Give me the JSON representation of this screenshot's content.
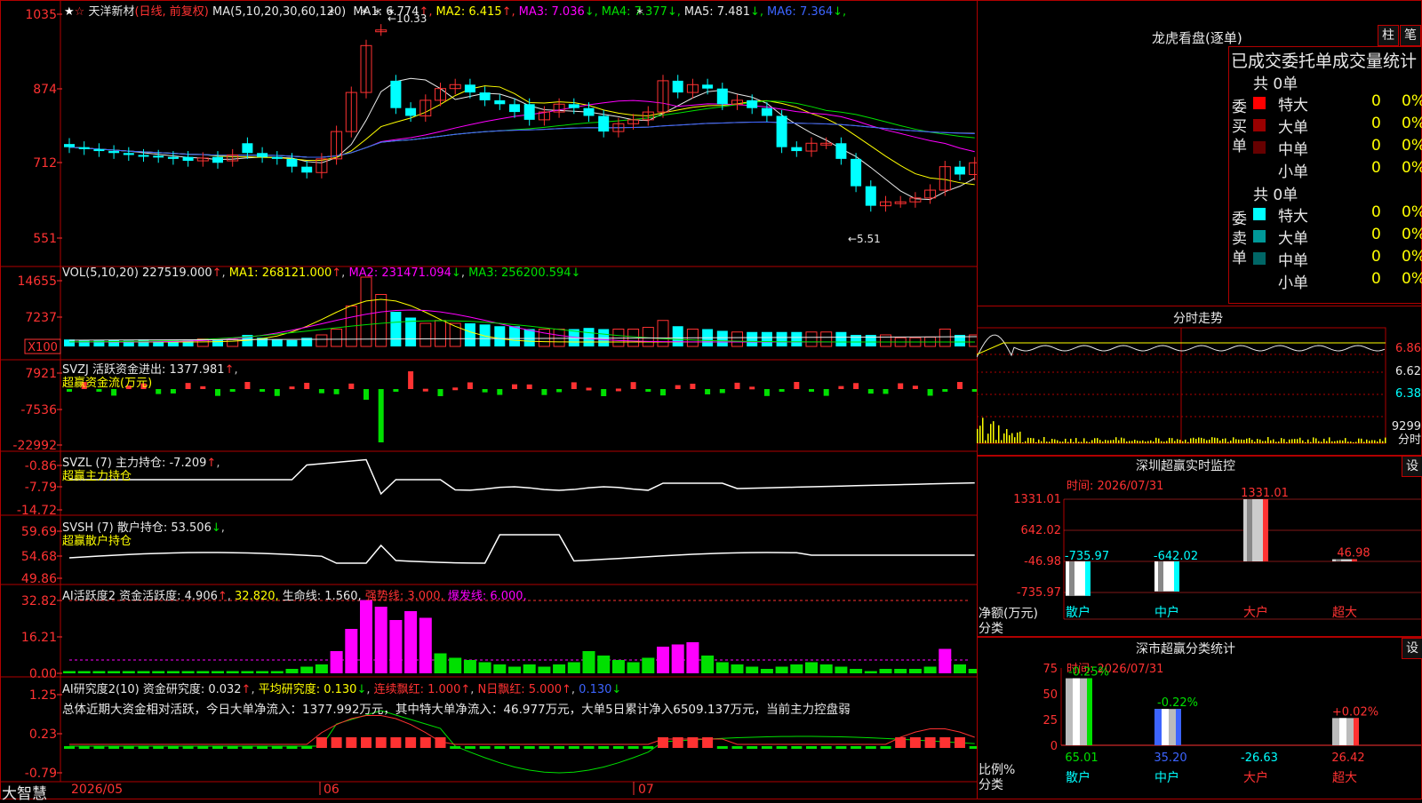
{
  "stock": {
    "name": "天洋新材",
    "mode": "(日线, 前复权)",
    "ma_params": "MA(5,10,20,30,60,120)"
  },
  "ma": [
    {
      "label": "MA1: 6.774",
      "color": "#e8e8e8",
      "arrow": "↑",
      "arrow_color": "#ff3232"
    },
    {
      "label": "MA2: 6.415",
      "color": "#ffff00",
      "arrow": "↑",
      "arrow_color": "#ff3232"
    },
    {
      "label": "MA3: 7.036",
      "color": "#ff00ff",
      "arrow": "↓",
      "arrow_color": "#00e000"
    },
    {
      "label": "MA4: 7.377",
      "color": "#00e000",
      "arrow": "↓",
      "arrow_color": "#00e000"
    },
    {
      "label": "MA5: 7.481",
      "color": "#e8e8e8",
      "arrow": "↓",
      "arrow_color": "#00e000"
    },
    {
      "label": "MA6: 7.364",
      "color": "#3c64ff",
      "arrow": "↓",
      "arrow_color": "#00e000"
    }
  ],
  "price_axis": [
    "1035",
    "874",
    "712",
    "551"
  ],
  "price_annotations": {
    "high": "←10.33",
    "low": "←5.51"
  },
  "vol": {
    "header": "VOL(5,10,20)",
    "value": "227519.000",
    "ma1": "MA1: 268121.000",
    "ma2": "MA2: 231471.094",
    "ma3": "MA3: 256200.594",
    "axis": [
      "14655",
      "7237"
    ],
    "unit": "X100"
  },
  "svzj": {
    "header": "SVZJ  活跃资金进出: 1377.981",
    "sub": "超赢资金流(万元)",
    "axis": [
      "7921",
      "-7536",
      "-22992"
    ]
  },
  "svzl": {
    "header": "SVZL (7) 主力持仓: -7.209",
    "sub": "超赢主力持仓",
    "axis": [
      "-0.86",
      "-7.79",
      "-14.72"
    ]
  },
  "svsh": {
    "header": "SVSH (7) 散户持仓: 53.506",
    "sub": "超赢散户持仓",
    "axis": [
      "59.69",
      "54.68",
      "49.86"
    ]
  },
  "ai1": {
    "header": "AI活跃度2 资金活跃度: 4.906",
    "v2": "32.820,",
    "v3": "生命线: 1.560,",
    "v4": "强势线: 3.000,",
    "v5": "爆发线: 6.000,",
    "axis": [
      "32.82",
      "16.21",
      "0.00"
    ]
  },
  "ai2": {
    "header": "AI研究度2(10) 资金研究度: 0.032",
    "v2": "平均研究度: 0.130",
    "v3": "连续飘红: 1.000",
    "v4": "N日飘红: 5.000",
    "v5": "0.130",
    "axis": [
      "1.25",
      "0.23",
      "-0.79"
    ],
    "summary": "总体近期大资金相对活跃，今日大单净流入：1377.992万元，其中特大单净流入：46.977万元，大单5日累计净入6509.137万元，当前主力控盘弱"
  },
  "date_axis": {
    "brand": "大智慧",
    "d1": "2026/05",
    "d2": "06",
    "d3": "07"
  },
  "right": {
    "dragon_title": "龙虎看盘(逐单)",
    "btn_bar": "柱",
    "btn_pen": "笔",
    "table_header": "已成交委托单成交量统计",
    "buy_label": "委买单",
    "sell_label": "委卖单",
    "buy_total": "共 0单",
    "sell_total": "共 0单",
    "buy_rows": [
      {
        "name": "特大",
        "count": "0",
        "pct": "0%",
        "color": "#ff0000"
      },
      {
        "name": "大单",
        "count": "0",
        "pct": "0%",
        "color": "#990000"
      },
      {
        "name": "中单",
        "count": "0",
        "pct": "0%",
        "color": "#660000"
      },
      {
        "name": "小单",
        "count": "0",
        "pct": "0%",
        "color": ""
      }
    ],
    "sell_rows": [
      {
        "name": "特大",
        "count": "0",
        "pct": "0%",
        "color": "#00ffff"
      },
      {
        "name": "大单",
        "count": "0",
        "pct": "0%",
        "color": "#009999"
      },
      {
        "name": "中单",
        "count": "0",
        "pct": "0%",
        "color": "#006666"
      },
      {
        "name": "小单",
        "count": "0",
        "pct": "0%",
        "color": ""
      }
    ],
    "fenshi_title": "分时走势",
    "fenshi_axis": [
      "6.86",
      "6.62",
      "6.38",
      "9299"
    ],
    "fenshi_unit": "分时",
    "monitor_title": "深圳超赢实时监控",
    "monitor_time": "时间: 2026/07/31",
    "monitor_btn": "设",
    "monitor_axis": [
      "1331.01",
      "642.02",
      "-46.98",
      "-735.97"
    ],
    "monitor_ylabel": "净额(万元)",
    "monitor_xlabel": "分类",
    "monitor_values": [
      "-735.97",
      "-642.02",
      "1331.01",
      "46.98"
    ],
    "categories": [
      "散户",
      "中户",
      "大户",
      "超大"
    ],
    "classify_title": "深市超赢分类统计",
    "classify_time": "时间: 2026/07/31",
    "classify_btn": "设",
    "classify_axis": [
      "75",
      "50",
      "25",
      "0"
    ],
    "classify_ylabel": "比例%",
    "classify_xlabel": "分类",
    "classify_top": [
      "-0.25%",
      "-0.22%",
      "",
      "+0.02%"
    ],
    "classify_bottom": [
      "65.01",
      "35.20",
      "-26.63",
      "26.42"
    ]
  },
  "chart_data": {
    "type": "bar",
    "title": "深圳超赢实时监控",
    "categories": [
      "散户",
      "中户",
      "大户",
      "超大"
    ],
    "series": [
      {
        "name": "净额(万元)",
        "values": [
          -735.97,
          -642.02,
          1331.01,
          46.98
        ]
      }
    ],
    "ylim": [
      -735.97,
      1331.01
    ]
  }
}
